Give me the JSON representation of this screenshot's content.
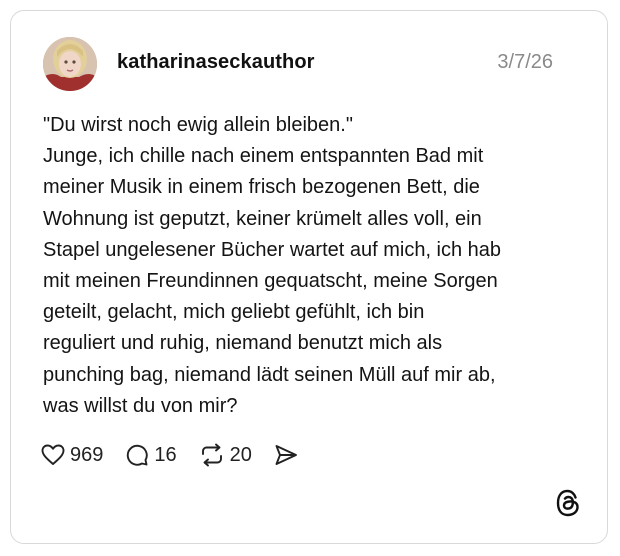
{
  "post": {
    "username": "katharinaseckauthor",
    "date": "3/7/26",
    "body_lines": [
      "\"Du wirst noch ewig allein bleiben.\"",
      "Junge, ich chille nach einem entspannten Bad mit",
      "meiner Musik in einem frisch bezogenen Bett, die",
      "Wohnung ist geputzt, keiner krümelt alles voll, ein",
      "Stapel ungelesener Bücher wartet auf mich, ich hab",
      "mit meinen Freundinnen gequatscht, meine Sorgen",
      "geteilt, gelacht, mich geliebt gefühlt, ich bin",
      "reguliert und ruhig, niemand benutzt mich als",
      "punching bag, niemand lädt seinen Müll auf mir ab,",
      "was willst du von mir?"
    ]
  },
  "actions": {
    "likes": {
      "icon": "heart-icon",
      "count": "969"
    },
    "replies": {
      "icon": "comment-icon",
      "count": "16"
    },
    "reposts": {
      "icon": "repost-icon",
      "count": "20"
    },
    "share": {
      "icon": "send-icon"
    }
  },
  "brand": {
    "logo": "threads-logo-icon"
  }
}
